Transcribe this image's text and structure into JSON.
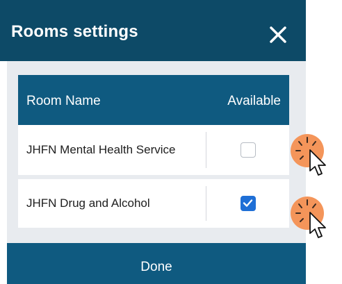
{
  "dialog": {
    "title": "Rooms settings",
    "close_icon": "close-icon",
    "table": {
      "headers": {
        "name": "Room Name",
        "available": "Available"
      },
      "rows": [
        {
          "name": "JHFN Mental Health Service",
          "available": false
        },
        {
          "name": "JHFN Drug and Alcohol",
          "available": true
        }
      ]
    },
    "footer": {
      "done_label": "Done"
    }
  },
  "colors": {
    "title_bar": "#0d4a67",
    "header": "#0f5a80",
    "body_bg": "#e8ebef",
    "checkbox_checked": "#1f6fd6",
    "click_indicator": "#f4955a"
  },
  "annotations": {
    "click_indicators": [
      {
        "icon": "cursor-click-icon",
        "target": "row-1-checkbox"
      },
      {
        "icon": "cursor-click-icon",
        "target": "row-2-checkbox"
      }
    ]
  }
}
